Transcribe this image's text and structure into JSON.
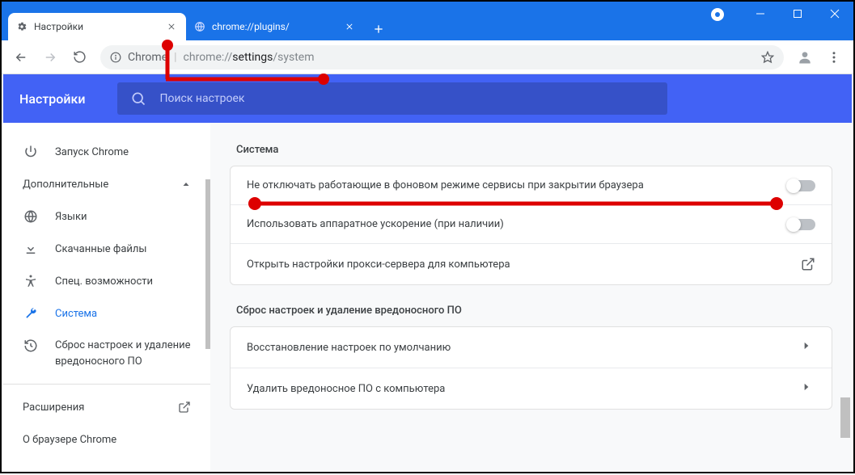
{
  "window": {
    "tabs": [
      {
        "title": "Настройки",
        "active": true
      },
      {
        "title": "chrome://plugins/",
        "active": false
      }
    ]
  },
  "toolbar": {
    "security_label": "Chrome",
    "url_prefix": "chrome://",
    "url_mid": "settings",
    "url_suffix": "/system"
  },
  "app": {
    "title": "Настройки",
    "search_placeholder": "Поиск настроек"
  },
  "sidebar": {
    "on_startup": "Запуск Chrome",
    "advanced": "Дополнительные",
    "languages": "Языки",
    "downloads": "Скачанные файлы",
    "accessibility": "Спец. возможности",
    "system": "Система",
    "reset": "Сброс настроек и удаление вредоносного ПО",
    "extensions": "Расширения",
    "about": "О браузере Chrome"
  },
  "sections": {
    "system": {
      "title": "Система",
      "rows": {
        "background": "Не отключать работающие в фоновом режиме сервисы при закрытии браузера",
        "hw_accel": "Использовать аппаратное ускорение (при наличии)",
        "proxy": "Открыть настройки прокси-сервера для компьютера"
      }
    },
    "reset": {
      "title": "Сброс настроек и удаление вредоносного ПО",
      "rows": {
        "restore": "Восстановление настроек по умолчанию",
        "cleanup": "Удалить вредоносное ПО с компьютера"
      }
    }
  }
}
